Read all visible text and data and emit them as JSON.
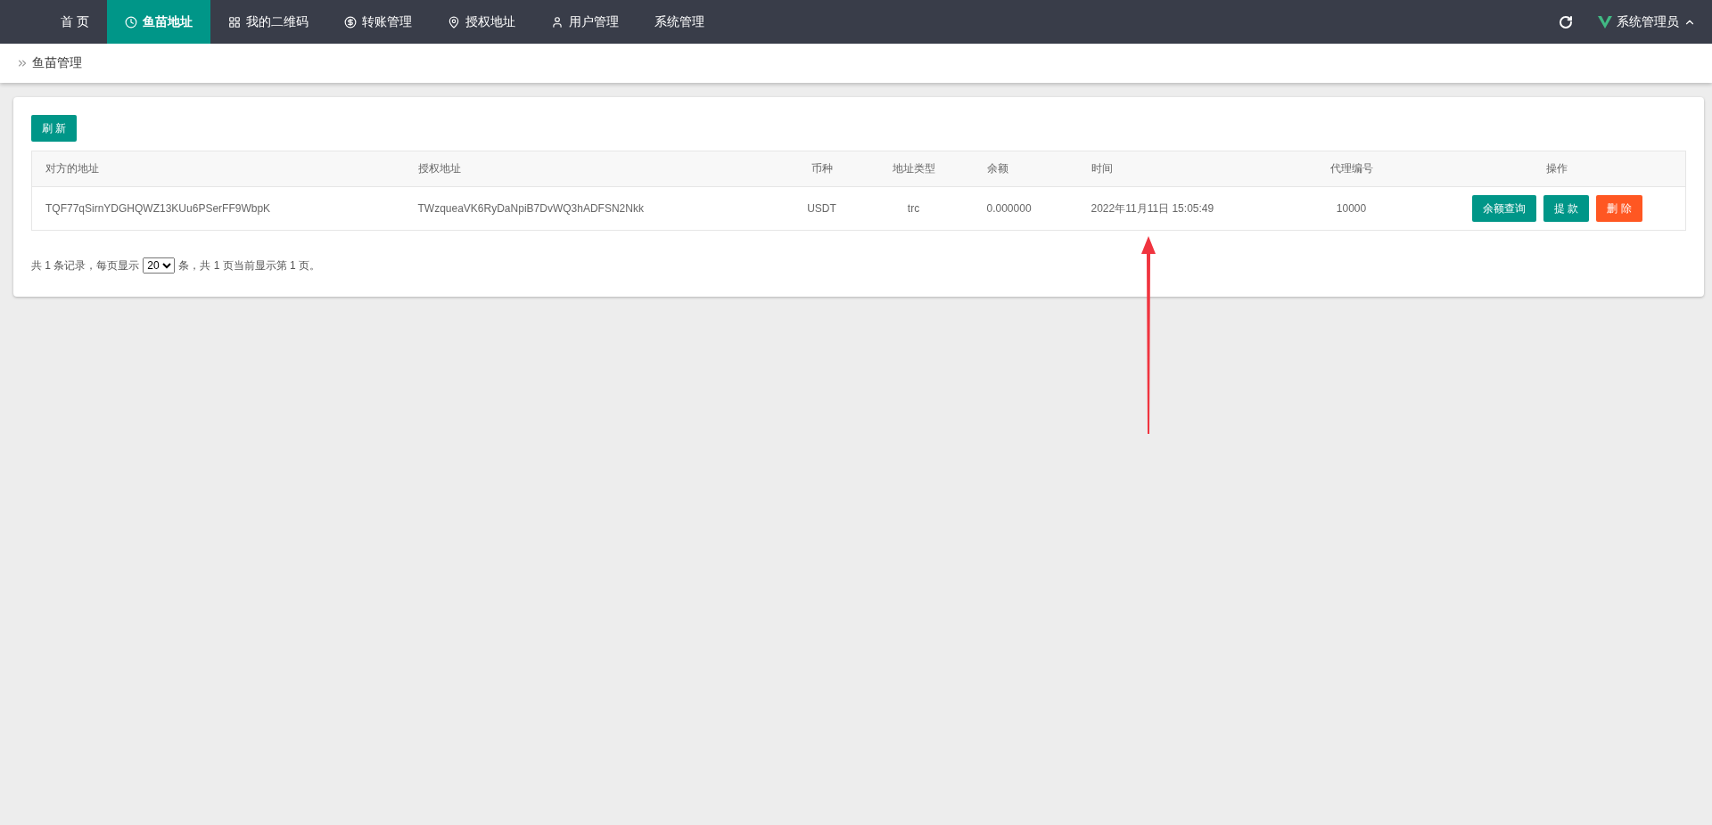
{
  "nav": {
    "items": [
      {
        "label": "首 页",
        "selected": false
      },
      {
        "label": "鱼苗地址",
        "selected": true
      },
      {
        "label": "我的二维码",
        "selected": false
      },
      {
        "label": "转账管理",
        "selected": false
      },
      {
        "label": "授权地址",
        "selected": false
      },
      {
        "label": "用户管理",
        "selected": false
      },
      {
        "label": "系统管理",
        "selected": false
      }
    ],
    "user": "系统管理员"
  },
  "breadcrumb": "鱼苗管理",
  "refresh_button": "刷 新",
  "table": {
    "columns": [
      "对方的地址",
      "授权地址",
      "币种",
      "地址类型",
      "余额",
      "时间",
      "代理编号",
      "操作"
    ],
    "rows": [
      {
        "cells": [
          "TQF77qSirnYDGHQWZ13KUu6PSerFF9WbpK",
          "TWzqueaVK6RyDaNpiB7DvWQ3hADFSN2Nkk",
          "USDT",
          "trc",
          "0.000000",
          "2022年11月11日 15:05:49",
          "10000"
        ],
        "actions": [
          {
            "label": "余额查询",
            "kind": "primary"
          },
          {
            "label": "提 款",
            "kind": "primary"
          },
          {
            "label": "删 除",
            "kind": "danger"
          }
        ]
      }
    ]
  },
  "pagination": {
    "before": "共 1 条记录，每页显示",
    "page_size": "20",
    "after": "条，共 1 页当前显示第 1 页。"
  }
}
